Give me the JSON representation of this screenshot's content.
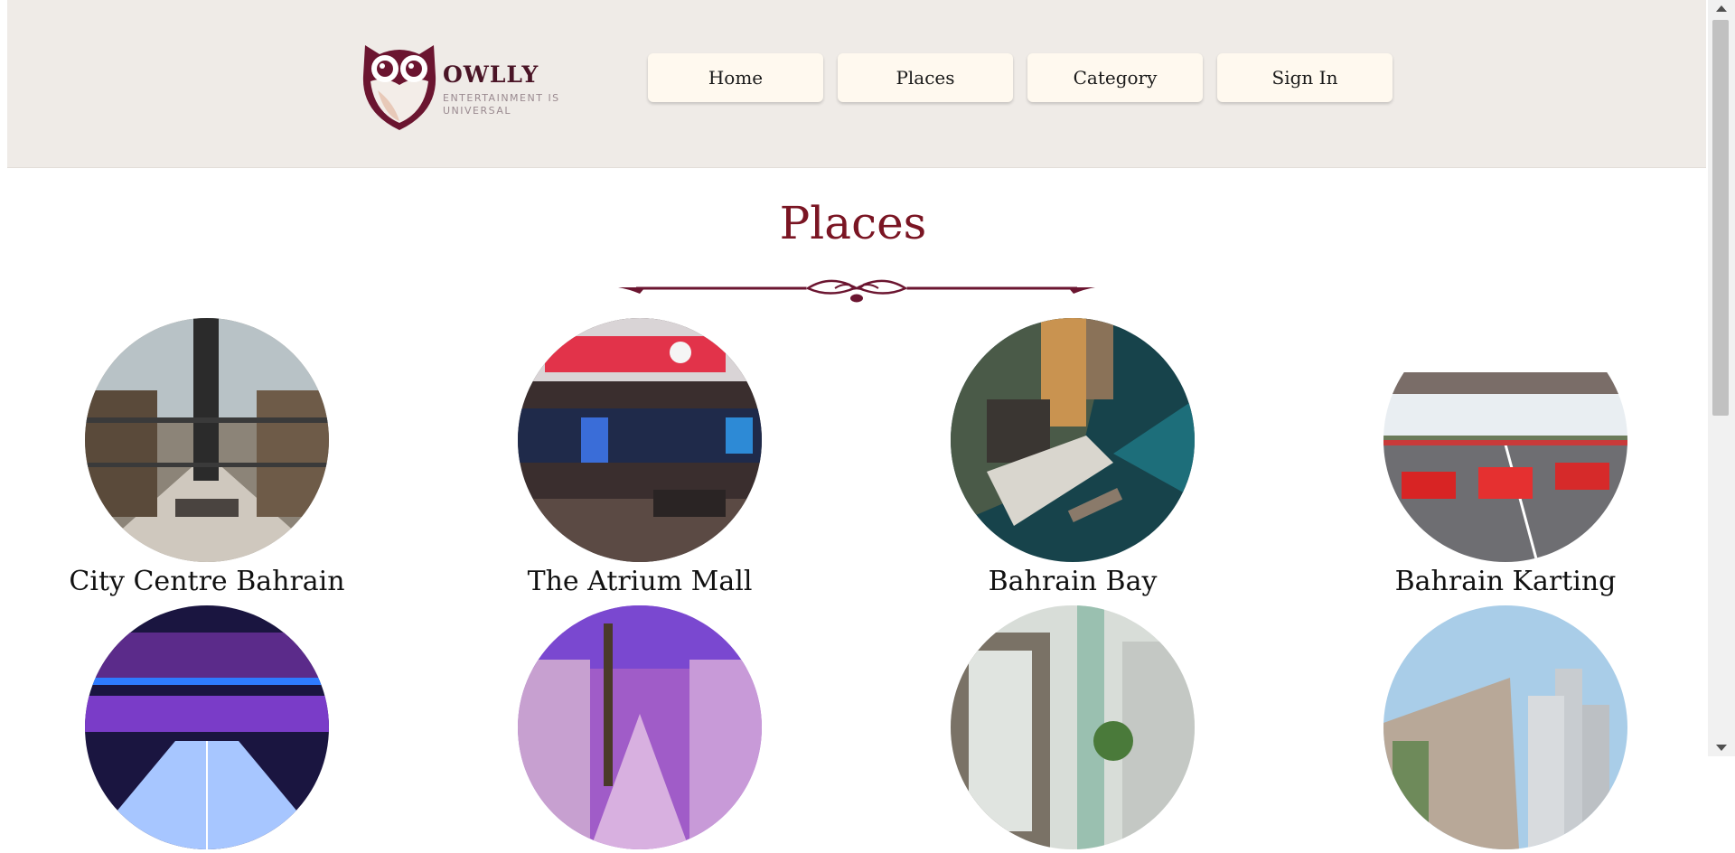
{
  "header": {
    "brand": "OWLLY",
    "tagline": "ENTERTAINMENT IS UNIVERSAL",
    "logo_icon": "owl-logo-icon",
    "nav": [
      {
        "label": "Home"
      },
      {
        "label": "Places"
      },
      {
        "label": "Category"
      },
      {
        "label": "Sign In"
      }
    ]
  },
  "main": {
    "title": "Places",
    "places": [
      {
        "name": "City Centre Bahrain"
      },
      {
        "name": "The Atrium Mall"
      },
      {
        "name": "Bahrain Bay"
      },
      {
        "name": "Bahrain Karting"
      },
      {
        "name": ""
      },
      {
        "name": ""
      },
      {
        "name": ""
      },
      {
        "name": ""
      }
    ]
  },
  "colors": {
    "header_bg": "#efebe7",
    "nav_button_bg": "#fff9ef",
    "title_color": "#7a1523",
    "brand_color": "#4a1426"
  }
}
